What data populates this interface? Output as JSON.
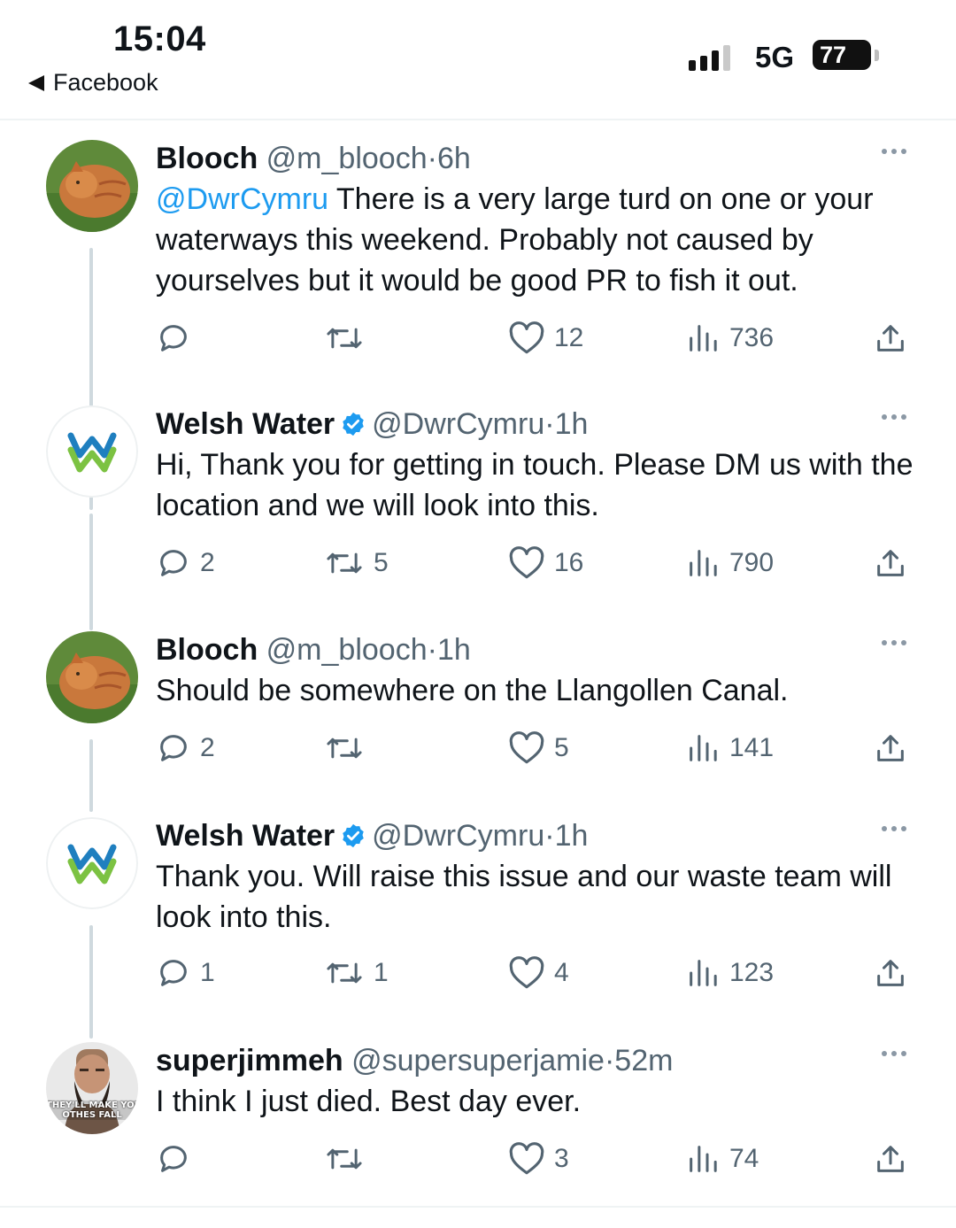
{
  "status_bar": {
    "time": "15:04",
    "back_app": "Facebook",
    "network": "5G",
    "battery": "77"
  },
  "tweets": [
    {
      "name": "Blooch",
      "handle": "@m_blooch",
      "separator": "·",
      "time": "6h",
      "verified": false,
      "mention": "@DwrCymru",
      "text": " There is a very large turd on one or your waterways this weekend. Probably not caused by yourselves but it would be good PR to fish it out.",
      "replies": "",
      "retweets": "",
      "likes": "12",
      "views": "736",
      "avatar": "cat-avatar"
    },
    {
      "name": "Welsh Water",
      "handle": "@DwrCymru",
      "separator": "·",
      "time": "1h",
      "verified": true,
      "mention": "",
      "text": "Hi, Thank you for getting in touch. Please DM us with the location and we will look into this.",
      "replies": "2",
      "retweets": "5",
      "likes": "16",
      "views": "790",
      "avatar": "welsh-water-logo"
    },
    {
      "name": "Blooch",
      "handle": "@m_blooch",
      "separator": "·",
      "time": "1h",
      "verified": false,
      "mention": "",
      "text": "Should be somewhere on the Llangollen Canal.",
      "replies": "2",
      "retweets": "",
      "likes": "5",
      "views": "141",
      "avatar": "cat-avatar"
    },
    {
      "name": "Welsh Water",
      "handle": "@DwrCymru",
      "separator": "·",
      "time": "1h",
      "verified": true,
      "mention": "",
      "text": "Thank you. Will raise this issue and our waste team will look into this.",
      "replies": "1",
      "retweets": "1",
      "likes": "4",
      "views": "123",
      "avatar": "welsh-water-logo"
    },
    {
      "name": "superjimmeh",
      "handle": "@supersuperjamie",
      "separator": "·",
      "time": "52m",
      "verified": false,
      "mention": "",
      "text": "I think I just died. Best day ever.",
      "replies": "",
      "retweets": "",
      "likes": "3",
      "views": "74",
      "avatar": "bearded-man-avatar",
      "avatar_caption": "THEY'LL MAKE YOU\nOTHES FALL"
    }
  ],
  "colors": {
    "text": "#0f1419",
    "secondary": "#536471",
    "mention": "#1d9bf0",
    "verified": "#1d9bf0",
    "thread_line": "#cfd9de",
    "welsh_water_blue": "#1f7fbf",
    "welsh_water_green": "#7cc242"
  }
}
